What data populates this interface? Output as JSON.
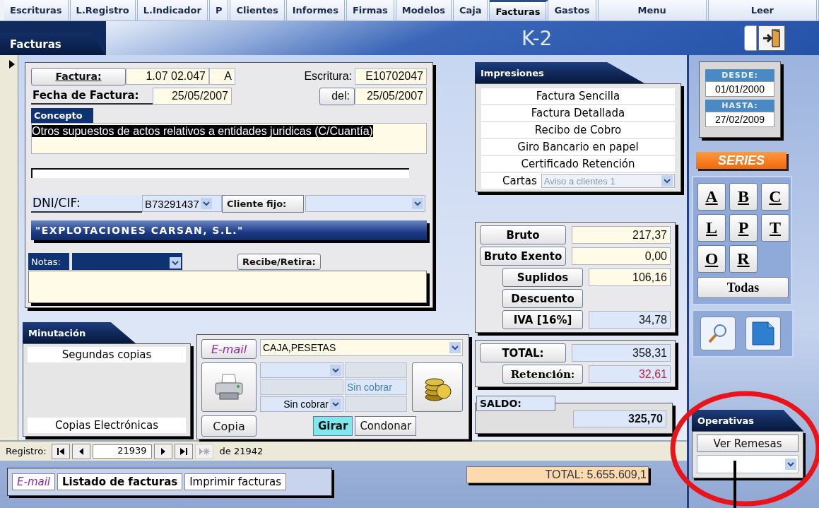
{
  "tabs": [
    {
      "label": "Escrituras",
      "selected": false
    },
    {
      "label": "L.Registro",
      "selected": false
    },
    {
      "label": "L.Indicador",
      "selected": false
    },
    {
      "label": "P",
      "selected": false
    },
    {
      "label": "Clientes",
      "selected": false
    },
    {
      "label": "Informes",
      "selected": false
    },
    {
      "label": "Firmas",
      "selected": false
    },
    {
      "label": "Modelos",
      "selected": false
    },
    {
      "label": "Caja",
      "selected": false
    },
    {
      "label": "Facturas",
      "selected": true
    },
    {
      "label": "Gastos",
      "selected": false
    },
    {
      "label": "Menu",
      "selected": false
    },
    {
      "label": "Leer",
      "selected": false
    }
  ],
  "header": {
    "section": "Facturas",
    "title": "K-2"
  },
  "invoice": {
    "factura_label": "Factura:",
    "number": "1.07 02.047",
    "series": "A",
    "escritura_label": "Escritura:",
    "escritura": "E10702047",
    "fecha_label": "Fecha de Factura:",
    "fecha": "25/05/2007",
    "del_label": "del:",
    "del": "25/05/2007",
    "concepto_label": "Concepto",
    "concepto": "Otros supuestos de actos relativos a entidades juridicas (C/Cuantía)",
    "dni_label": "DNI/CIF:",
    "dni": "B73291437",
    "cliente_fijo_label": "Cliente fijo:",
    "client_name": "\"EXPLOTACIONES CARSAN, S.L.\"",
    "notas_label": "Notas:",
    "recibe_button": "Recibe/Retira:"
  },
  "impresiones": {
    "title": "Impresiones",
    "items": [
      "Factura Sencilla",
      "Factura Detallada",
      "Recibo de Cobro",
      "Giro Bancario en papel",
      "Certificado Retención"
    ],
    "cartas_label": "Cartas",
    "cartas_value": "Aviso a clientes 1"
  },
  "amounts": [
    {
      "label": "Bruto",
      "value": "217,37",
      "kind": "base"
    },
    {
      "label": "Bruto Exento",
      "value": "0,00",
      "kind": "base"
    },
    {
      "label": "Suplidos",
      "value": "106,16",
      "kind": "extra"
    },
    {
      "label": "Descuento",
      "kind": "extra"
    },
    {
      "label": "IVA [16%]",
      "value": "34,78",
      "kind": "tax"
    }
  ],
  "totals": [
    {
      "label": "TOTAL:",
      "value": "358,31",
      "kind": "total"
    },
    {
      "label": "Retención:",
      "value": "32,61",
      "kind": "retention"
    }
  ],
  "saldo": {
    "label": "SALDO:",
    "value": "325,70"
  },
  "dates": {
    "desde_label": "DESDE:",
    "desde": "01/01/2000",
    "hasta_label": "HASTA:",
    "hasta": "27/02/2009"
  },
  "series": {
    "title": "SERIES",
    "buttons": [
      "A",
      "B",
      "C",
      "L",
      "P",
      "T",
      "O",
      "R"
    ],
    "all": "Todas"
  },
  "minutacion": {
    "title": "Minutación",
    "items": [
      "Segundas copias",
      "Copias Electrónicas"
    ]
  },
  "cobro": {
    "email": "E-mail",
    "account": "CAJA,PESETAS",
    "status_right": "Sin cobrar",
    "status_left": "Sin cobrar",
    "copy": "Copia",
    "buttons": [
      {
        "label": "Girar",
        "selected": true
      },
      {
        "label": "Condonar",
        "selected": false
      }
    ]
  },
  "navigation": {
    "label": "Registro:",
    "current": "21939",
    "of": "de 21942"
  },
  "bottom_buttons": [
    {
      "label": "E-mail",
      "kind": "email"
    },
    {
      "label": "Listado de facturas",
      "kind": "bold"
    },
    {
      "label": "Imprimir facturas",
      "kind": "plain"
    }
  ],
  "grand_total": "TOTAL: 5.655.609,1",
  "operativas": {
    "title": "Operativas",
    "button": "Ver Remesas"
  }
}
